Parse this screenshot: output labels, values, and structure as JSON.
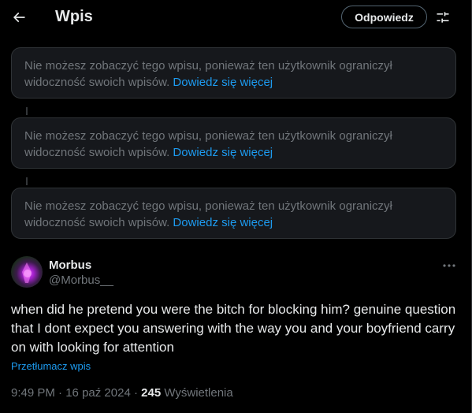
{
  "header": {
    "title": "Wpis",
    "reply_label": "Odpowiedz",
    "back_icon": "arrow-left-icon",
    "settings_icon": "sliders-icon"
  },
  "notices": [
    {
      "text": "Nie możesz zobaczyć tego wpisu, ponieważ ten użytkownik ograniczył widoczność swoich wpisów.",
      "link": "Dowiedz się więcej"
    },
    {
      "text": "Nie możesz zobaczyć tego wpisu, ponieważ ten użytkownik ograniczył widoczność swoich wpisów.",
      "link": "Dowiedz się więcej"
    },
    {
      "text": "Nie możesz zobaczyć tego wpisu, ponieważ ten użytkownik ograniczył widoczność swoich wpisów.",
      "link": "Dowiedz się więcej"
    }
  ],
  "post": {
    "author_name": "Morbus",
    "author_handle": "@Morbus__",
    "text": "when did he pretend you were the bitch for blocking him? genuine question that I dont expect you answering with the way you and your boyfriend carry on with looking for attention",
    "translate_label": "Przetłumacz wpis",
    "time": "9:49 PM",
    "date": "16 paź 2024",
    "views_count": "245",
    "views_label": "Wyświetlenia",
    "more_icon": "more-dots-icon"
  },
  "colors": {
    "background": "#000000",
    "text": "#e7e9ea",
    "muted": "#71767b",
    "accent": "#1d9bf0",
    "card": "#16181c",
    "border": "#2f3336"
  }
}
